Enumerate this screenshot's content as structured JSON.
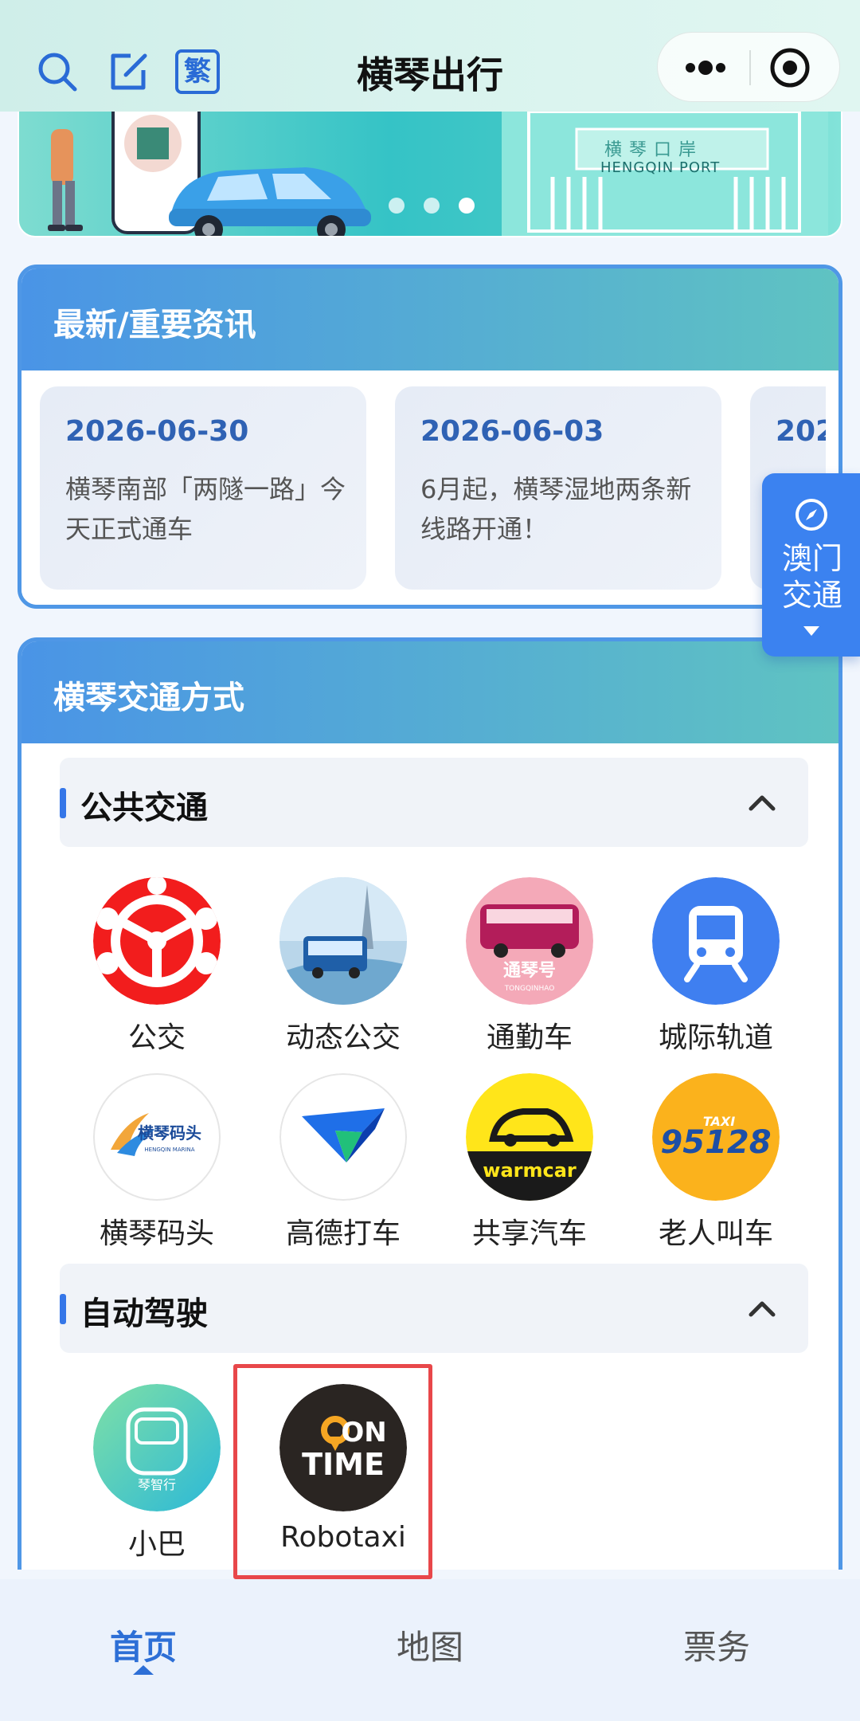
{
  "header": {
    "title": "横琴出行",
    "trad_label": "繁"
  },
  "banner": {
    "port_text": "HENGQIN PORT",
    "port_chars": "横 琴 口 岸",
    "pager_count": 3
  },
  "news": {
    "title": "最新/重要资讯",
    "items": [
      {
        "date": "2026-06-30",
        "text": "横琴南部「两隧一路」今天正式通车"
      },
      {
        "date": "2026-06-03",
        "text": "6月起，横琴湿地两条新线路开通！"
      },
      {
        "date": "202",
        "text": ""
      }
    ]
  },
  "floating": {
    "label": "澳门交通"
  },
  "transport": {
    "title": "横琴交通方式",
    "public": {
      "label": "公共交通",
      "items": [
        {
          "label": "公交",
          "icon": "bus-steering-icon"
        },
        {
          "label": "动态公交",
          "icon": "dynamic-bus-icon"
        },
        {
          "label": "通勤车",
          "icon": "commuter-bus-icon",
          "badge": "通琴号",
          "badge_en": "TONGQINHAO"
        },
        {
          "label": "城际轨道",
          "icon": "train-icon"
        },
        {
          "label": "横琴码头",
          "icon": "ferry-terminal-icon",
          "badge": "横琴码头",
          "badge_en": "HENGQIN MARINA"
        },
        {
          "label": "高德打车",
          "icon": "amap-taxi-icon"
        },
        {
          "label": "共享汽车",
          "icon": "warmcar-icon",
          "badge": "warmcar"
        },
        {
          "label": "老人叫车",
          "icon": "taxi-95128-icon",
          "badge": "95128",
          "badge_small": "TAXI"
        }
      ]
    },
    "auto": {
      "label": "自动驾驶",
      "items": [
        {
          "label": "小巴",
          "icon": "minibus-icon",
          "badge": "琴智行"
        },
        {
          "label": "Robotaxi",
          "icon": "ontime-icon",
          "badge_top": "ON",
          "badge_bottom": "TIME"
        }
      ]
    }
  },
  "nav": {
    "items": [
      {
        "label": "首页",
        "active": true
      },
      {
        "label": "地图",
        "active": false
      },
      {
        "label": "票务",
        "active": false
      }
    ]
  },
  "colors": {
    "accent": "#3576e8",
    "card_border": "#4f97e6",
    "highlight": "#e8474a",
    "active_nav": "#2d6fd6"
  }
}
